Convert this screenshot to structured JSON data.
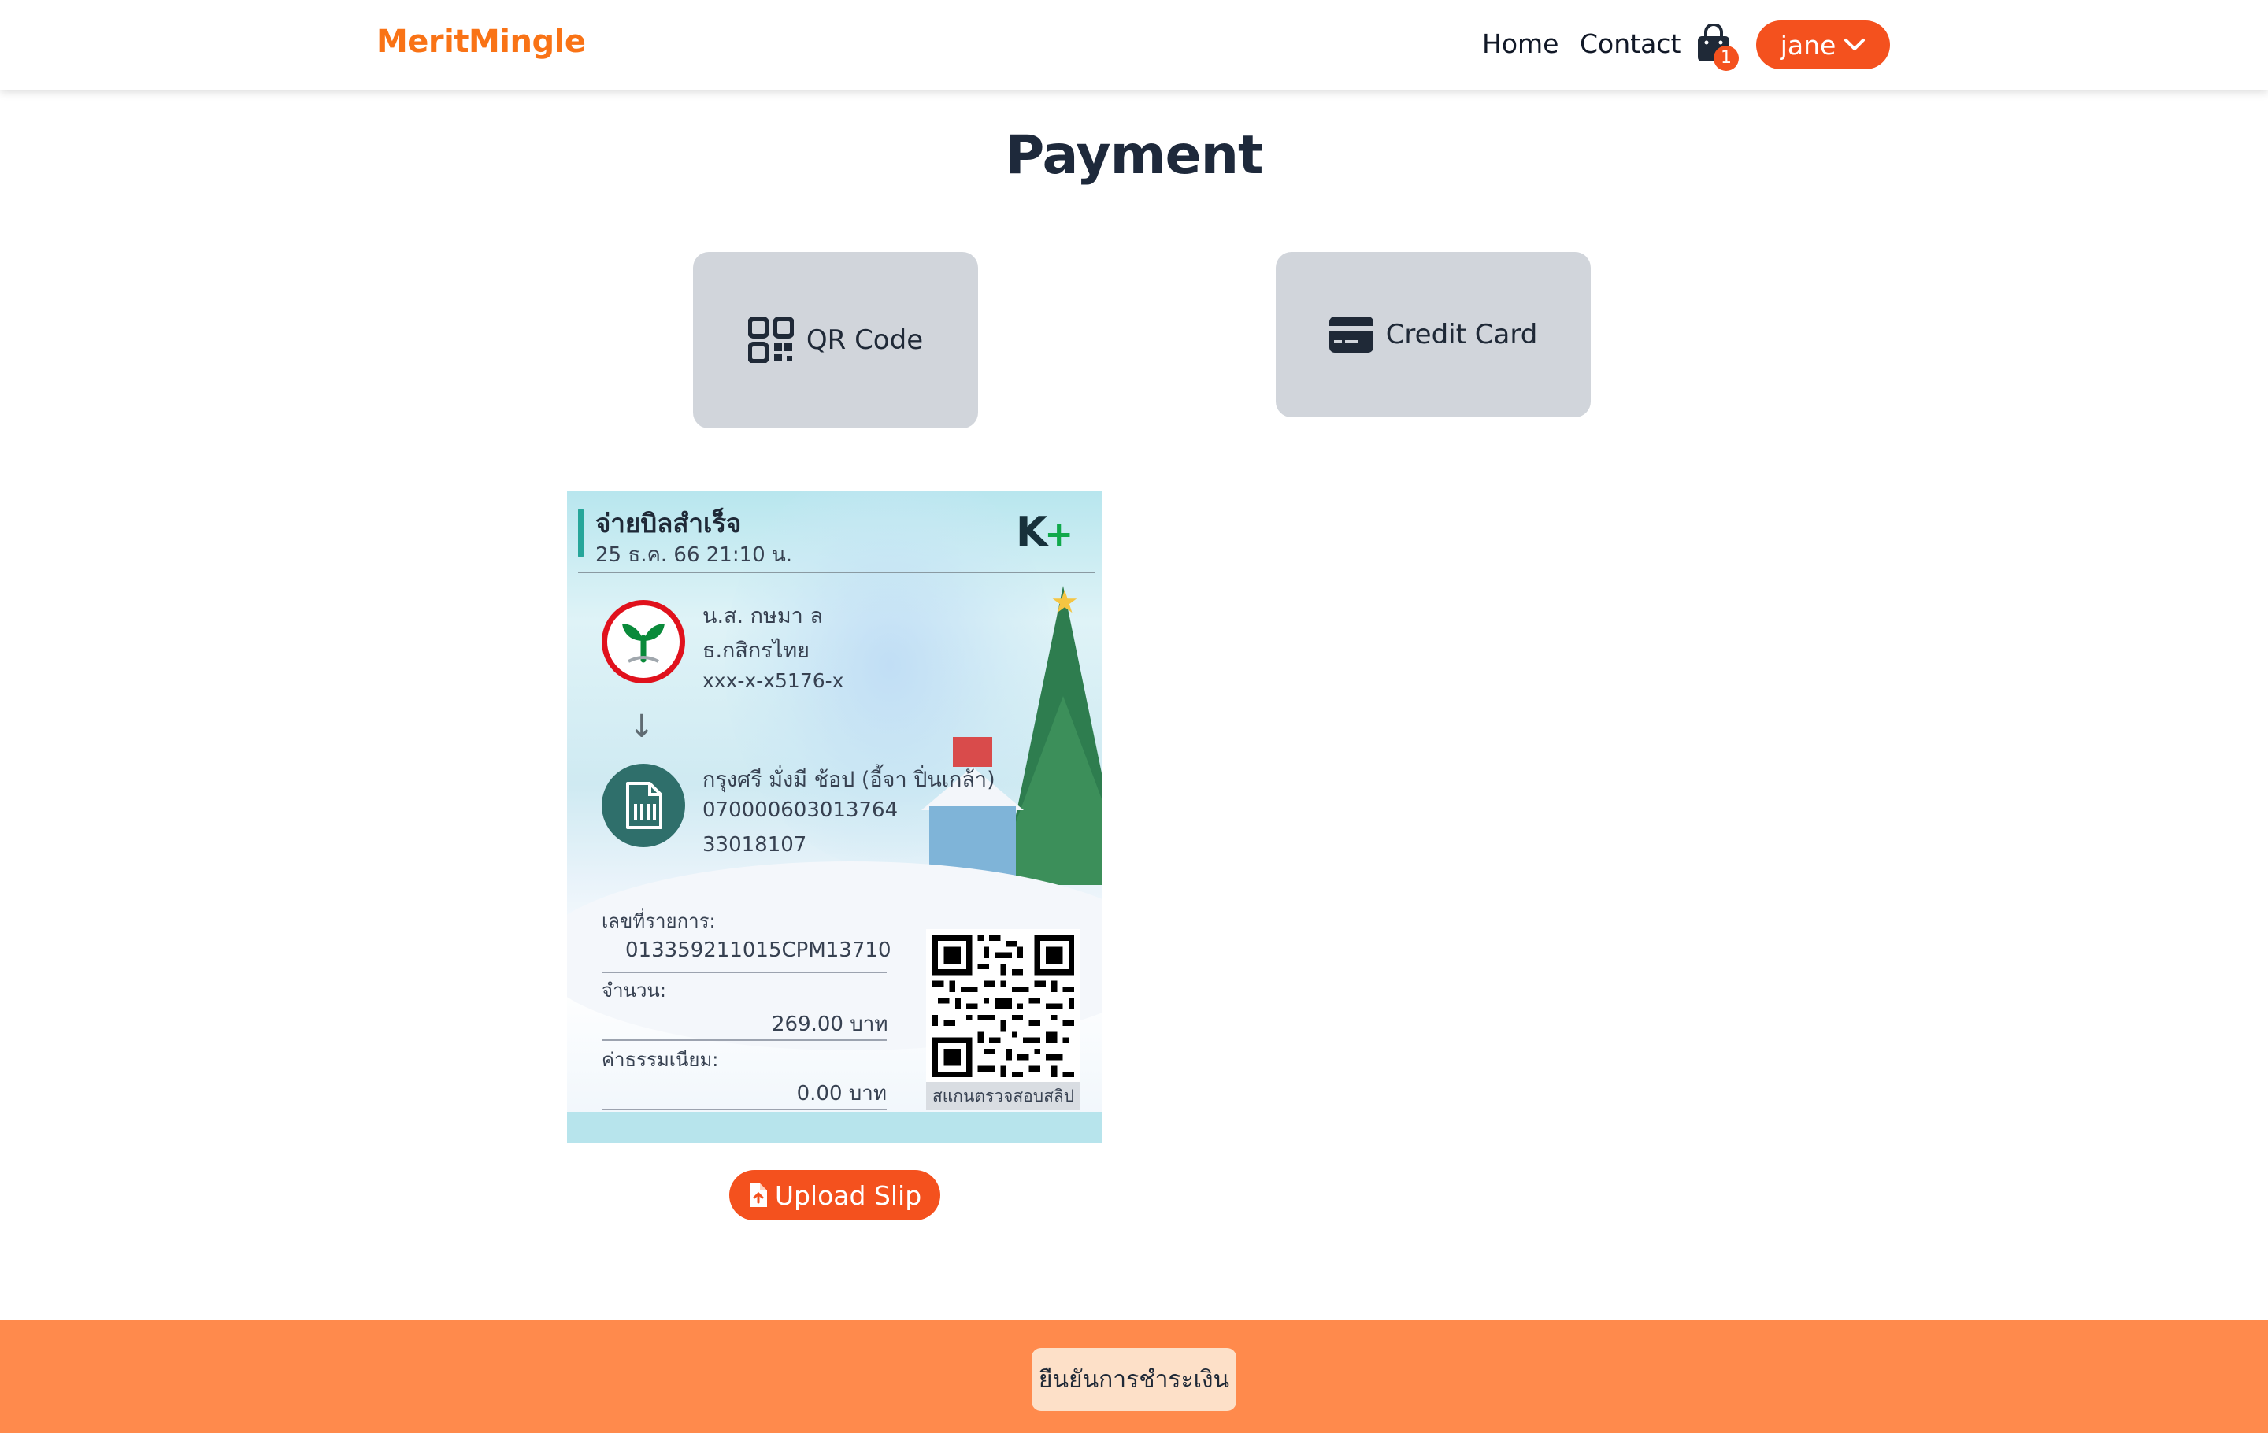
{
  "navbar": {
    "logo": "MeritMingle",
    "links": {
      "home": "Home",
      "contact": "Contact"
    },
    "cart_count": "1",
    "user_name": "jane",
    "cart_icon": "shopping-bag-icon",
    "user_menu_icon": "chevron-down-icon"
  },
  "page": {
    "title": "Payment"
  },
  "methods": {
    "qr": {
      "label": "QR Code",
      "icon": "qr-code-icon"
    },
    "card": {
      "label": "Credit Card",
      "icon": "credit-card-icon"
    }
  },
  "slip": {
    "title": "จ่ายบิลสำเร็จ",
    "datetime": "25 ธ.ค. 66  21:10 น.",
    "brand": "K+",
    "sender": {
      "name": "น.ส. กษมา ล",
      "bank": "ธ.กสิกรไทย",
      "account": "xxx-x-x5176-x"
    },
    "receiver": {
      "name": "กรุงศรี มั่งมี ช้อป (อี้จา ปิ่นเกล้า)",
      "ref1": "070000603013764",
      "ref2": "33018107"
    },
    "transaction_label": "เลขที่รายการ:",
    "transaction_id": "013359211015CPM13710",
    "amount_label": "จำนวน:",
    "amount": "269.00 บาท",
    "fee_label": "ค่าธรรมเนียม:",
    "fee": "0.00 บาท",
    "qr_caption": "สแกนตรวจสอบสลิป"
  },
  "upload": {
    "label": "Upload Slip",
    "icon": "file-upload-icon"
  },
  "footer": {
    "confirm_label": "ยืนยันการชำระเงิน"
  },
  "colors": {
    "brand": "#f97316",
    "accent": "#f4511e",
    "footer": "#ff8a4c",
    "card_bg": "#d1d5db"
  }
}
